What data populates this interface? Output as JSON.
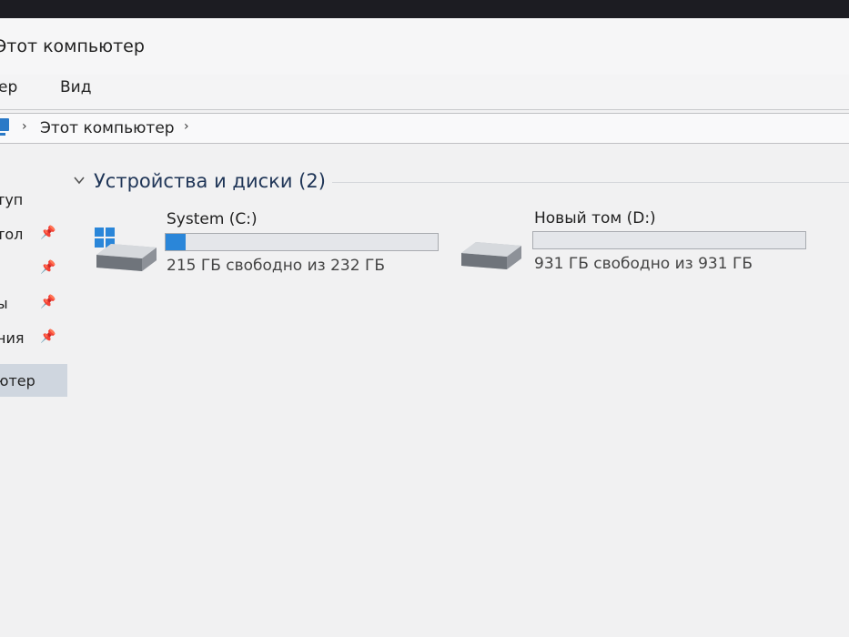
{
  "window": {
    "title": "Этот компьютер"
  },
  "menu": {
    "items": [
      {
        "label": "ер"
      },
      {
        "label": "Вид"
      }
    ]
  },
  "address": {
    "crumb": "Этот компьютер"
  },
  "sidebar": {
    "items": [
      {
        "label": "туп",
        "pinned": false
      },
      {
        "label": "тол",
        "pinned": true
      },
      {
        "label": "",
        "pinned": true
      },
      {
        "label": "ы",
        "pinned": true
      },
      {
        "label": "ния",
        "pinned": true
      },
      {
        "label": "ютер",
        "pinned": false,
        "selected": true
      }
    ]
  },
  "devices": {
    "group_title": "Устройства и диски (2)",
    "drives": [
      {
        "name": "System (C:)",
        "free_text": "215 ГБ свободно из 232 ГБ",
        "used_fraction": 0.073,
        "icon": "windows-hdd-icon"
      },
      {
        "name": "Новый том (D:)",
        "free_text": "931 ГБ свободно из 931 ГБ",
        "used_fraction": 0.0,
        "icon": "hdd-icon"
      }
    ]
  },
  "colors": {
    "accent": "#2a86d9",
    "group_header": "#1f3557"
  }
}
